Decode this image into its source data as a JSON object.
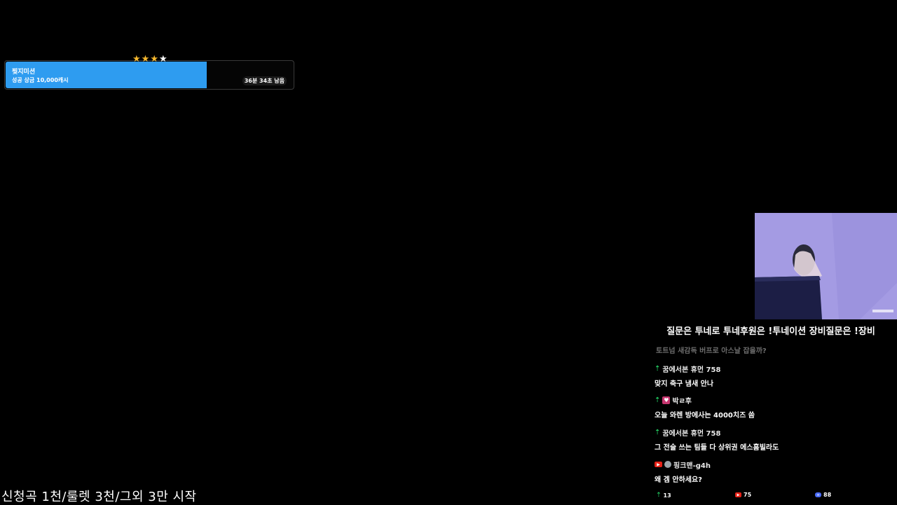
{
  "mission": {
    "title": "찢지미션",
    "reward": "성공 상금 10,000캐시",
    "time_left": "36분 34초 남음",
    "progress_fraction": 0.7,
    "stars_filled": 3,
    "stars_total": 4,
    "bar_color": "#2e9cf0"
  },
  "ticker": "신청곡 1천/룰렛 3천/그외 3만 시작",
  "chat": {
    "notice": "질문은 투네로 투네후원은 !투네이션 장비질문은 !장비",
    "faded_message": "토트넘 새감독 버프로 아스날 잡을까?",
    "messages": [
      {
        "user": "꿈에서본 휴먼 758",
        "text": "맞지 축구 냄새 안나",
        "badge": "up-arrow-icon"
      },
      {
        "user": "박ㄹ후",
        "text": "오늘 와렌 방에사는 4000치즈 씀",
        "badge": "heart-icon"
      },
      {
        "user": "꿈에서본 휴먼 758",
        "text": "그 전술 쓰는 팀들 다 상위권 에스홈빌라도",
        "badge": "up-arrow-icon"
      },
      {
        "user": "핑크맨-g4h",
        "text": "왜 겜 안하세요?",
        "badge": "youtube-icon"
      }
    ]
  },
  "viewer_stats": {
    "platform_a": "13",
    "youtube": "75",
    "platform_b": "88"
  },
  "colors": {
    "accent_green": "#22c55e",
    "youtube_red": "#e62117",
    "heart_pink": "#c6356f"
  }
}
